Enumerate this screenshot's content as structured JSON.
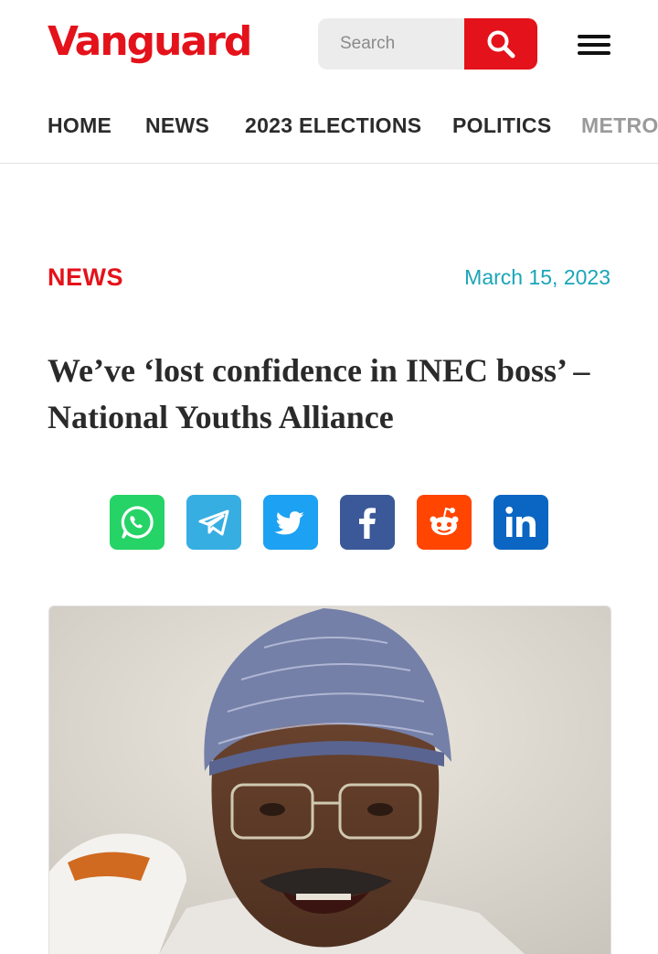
{
  "header": {
    "logo_text": "Vanguard",
    "search": {
      "placeholder": "Search",
      "icon": "search-icon"
    },
    "menu_icon": "hamburger-menu-icon"
  },
  "nav": {
    "items": [
      {
        "label": "HOME"
      },
      {
        "label": "NEWS"
      },
      {
        "label": "2023 ELECTIONS"
      },
      {
        "label": "POLITICS"
      },
      {
        "label": "METRO"
      }
    ]
  },
  "article": {
    "category": "NEWS",
    "date": "March 15, 2023",
    "title": "We’ve ‘lost confidence in INEC boss’ – National Youths Alliance"
  },
  "share": {
    "buttons": [
      {
        "network": "whatsapp",
        "icon": "whatsapp-icon",
        "color": "#25d366"
      },
      {
        "network": "telegram",
        "icon": "telegram-icon",
        "color": "#37aee2"
      },
      {
        "network": "twitter",
        "icon": "twitter-icon",
        "color": "#1da1f2"
      },
      {
        "network": "facebook",
        "icon": "facebook-icon",
        "color": "#3b5998"
      },
      {
        "network": "reddit",
        "icon": "reddit-icon",
        "color": "#ff4500"
      },
      {
        "network": "linkedin",
        "icon": "linkedin-icon",
        "color": "#0a66c2"
      }
    ]
  },
  "colors": {
    "brand_red": "#e4121a",
    "date_teal": "#1aa5b8",
    "text_dark": "#2a2a2a"
  }
}
